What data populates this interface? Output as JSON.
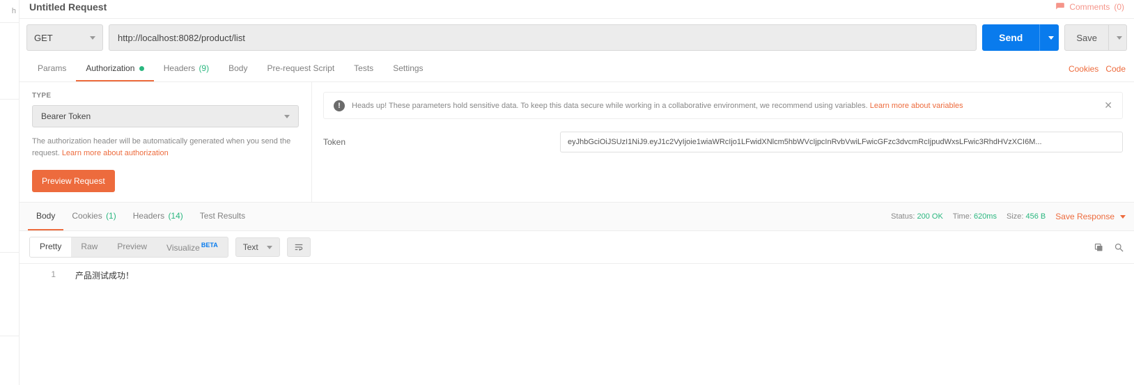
{
  "title": "Untitled Request",
  "comments": {
    "label": "Comments",
    "count": "(0)"
  },
  "request": {
    "method": "GET",
    "url": "http://localhost:8082/product/list",
    "send": "Send",
    "save": "Save"
  },
  "tabs": {
    "params": "Params",
    "authorization": "Authorization",
    "headers": "Headers",
    "headers_count": "(9)",
    "body": "Body",
    "prerequest": "Pre-request Script",
    "tests": "Tests",
    "settings": "Settings",
    "cookies": "Cookies",
    "code": "Code"
  },
  "auth": {
    "type_label": "TYPE",
    "type_value": "Bearer Token",
    "desc": "The authorization header will be automatically generated when you send the request. ",
    "learn_more": "Learn more about authorization",
    "preview": "Preview Request",
    "alert_text": "Heads up! These parameters hold sensitive data. To keep this data secure while working in a collaborative environment, we recommend using variables. ",
    "alert_link": "Learn more about variables",
    "token_label": "Token",
    "token_value": "eyJhbGciOiJSUzI1NiJ9.eyJ1c2VyIjoie1wiaWRcIjo1LFwidXNlcm5hbWVcIjpcInRvbVwiLFwicGFzc3dvcmRcIjpudWxsLFwic3RhdHVzXCI6M..."
  },
  "resp_tabs": {
    "body": "Body",
    "cookies": "Cookies",
    "cookies_count": "(1)",
    "headers": "Headers",
    "headers_count": "(14)",
    "test_results": "Test Results"
  },
  "status": {
    "status_label": "Status:",
    "status_value": "200 OK",
    "time_label": "Time:",
    "time_value": "620ms",
    "size_label": "Size:",
    "size_value": "456 B",
    "save_response": "Save Response"
  },
  "body_toolbar": {
    "pretty": "Pretty",
    "raw": "Raw",
    "preview": "Preview",
    "visualize": "Visualize",
    "beta": "BETA",
    "format": "Text"
  },
  "response_body": {
    "line_no": "1",
    "content": "产品测试成功！"
  },
  "left_edge": {
    "h": "h"
  }
}
